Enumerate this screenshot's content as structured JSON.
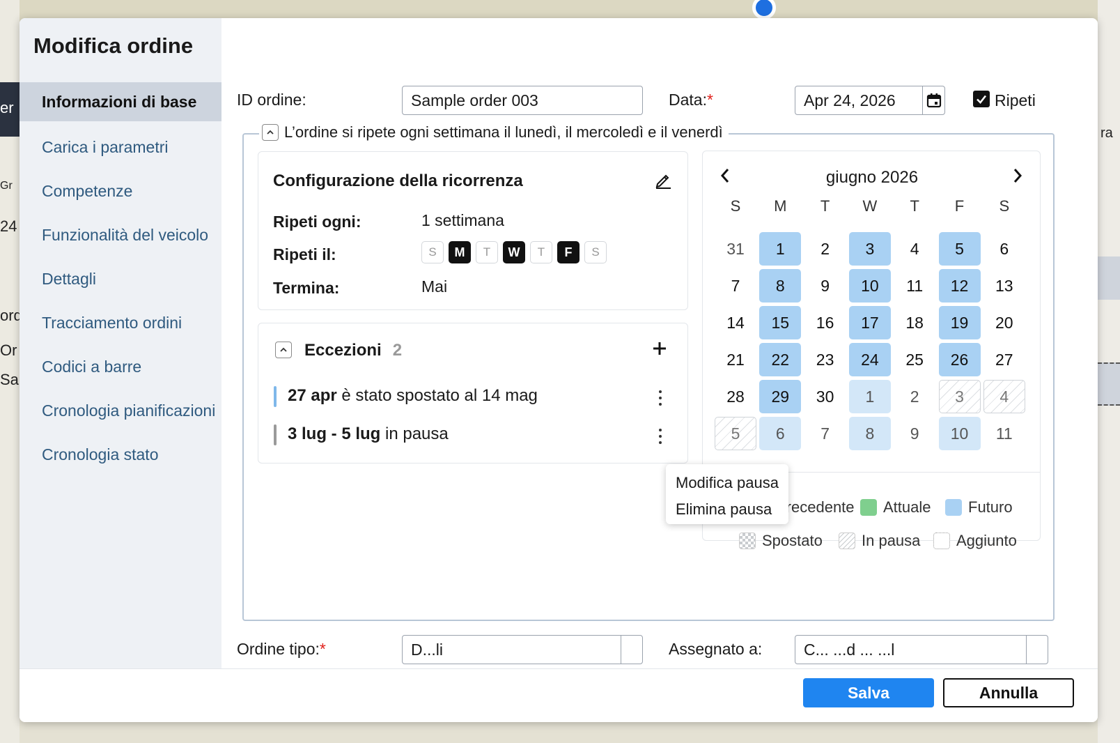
{
  "background": {
    "left_texts": [
      "er",
      "Gr",
      "24",
      "ord",
      "Or",
      "Sa"
    ],
    "right_text": "ra"
  },
  "modal": {
    "title": "Modifica ordine"
  },
  "sidebar": {
    "items": [
      {
        "label": "Informazioni di base",
        "active": true
      },
      {
        "label": "Carica i parametri"
      },
      {
        "label": "Competenze"
      },
      {
        "label": "Funzionalità del veicolo"
      },
      {
        "label": "Dettagli"
      },
      {
        "label": "Tracciamento ordini"
      },
      {
        "label": "Codici a barre"
      },
      {
        "label": "Cronologia pianificazioni"
      },
      {
        "label": "Cronologia stato"
      }
    ]
  },
  "form": {
    "order_id_label": "ID ordine:",
    "order_id_value": "Sample order 003",
    "date_label": "Data:",
    "required_mark": "*",
    "date_value": "Apr 24, 2026",
    "repeat_label": "Ripeti",
    "repeat_checked": true,
    "order_type_label": "Ordine tipo:",
    "order_type_value": "D...li",
    "assigned_label": "Assegnato a:",
    "assigned_value": "C... ...d ... ...l"
  },
  "recurrence": {
    "summary": "L’ordine si ripete ogni settimana il lunedì, il mercoledì e il venerdì",
    "config_title": "Configurazione della ricorrenza",
    "repeat_every_label": "Ripeti ogni:",
    "repeat_every_value": "1 settimana",
    "repeat_on_label": "Ripeti il:",
    "days": [
      {
        "letter": "S",
        "on": false
      },
      {
        "letter": "M",
        "on": true
      },
      {
        "letter": "T",
        "on": false
      },
      {
        "letter": "W",
        "on": true
      },
      {
        "letter": "T",
        "on": false
      },
      {
        "letter": "F",
        "on": true
      },
      {
        "letter": "S",
        "on": false
      }
    ],
    "ends_label": "Termina:",
    "ends_value": "Mai"
  },
  "exceptions": {
    "title": "Eccezioni",
    "count": "2",
    "items": [
      {
        "bold": "27 apr",
        "text": " è stato spostato al 14 mag",
        "color": "#7fb8ea"
      },
      {
        "bold": "3 lug - 5 lug",
        "text": " in pausa",
        "color": "#9a9a9a"
      }
    ]
  },
  "popup_menu": {
    "items": [
      "Modifica pausa",
      "Elimina pausa"
    ]
  },
  "calendar": {
    "month": "giugno 2026",
    "weekdays": [
      "S",
      "M",
      "T",
      "W",
      "T",
      "F",
      "S"
    ],
    "weeks": [
      [
        {
          "d": "31",
          "s": "muted"
        },
        {
          "d": "1",
          "s": "fut"
        },
        {
          "d": "2",
          "s": ""
        },
        {
          "d": "3",
          "s": "fut"
        },
        {
          "d": "4",
          "s": ""
        },
        {
          "d": "5",
          "s": "fut"
        },
        {
          "d": "6",
          "s": ""
        }
      ],
      [
        {
          "d": "7",
          "s": ""
        },
        {
          "d": "8",
          "s": "fut"
        },
        {
          "d": "9",
          "s": ""
        },
        {
          "d": "10",
          "s": "fut"
        },
        {
          "d": "11",
          "s": ""
        },
        {
          "d": "12",
          "s": "fut"
        },
        {
          "d": "13",
          "s": ""
        }
      ],
      [
        {
          "d": "14",
          "s": ""
        },
        {
          "d": "15",
          "s": "fut"
        },
        {
          "d": "16",
          "s": ""
        },
        {
          "d": "17",
          "s": "fut"
        },
        {
          "d": "18",
          "s": ""
        },
        {
          "d": "19",
          "s": "fut"
        },
        {
          "d": "20",
          "s": ""
        }
      ],
      [
        {
          "d": "21",
          "s": ""
        },
        {
          "d": "22",
          "s": "fut"
        },
        {
          "d": "23",
          "s": ""
        },
        {
          "d": "24",
          "s": "fut"
        },
        {
          "d": "25",
          "s": ""
        },
        {
          "d": "26",
          "s": "fut"
        },
        {
          "d": "27",
          "s": ""
        }
      ],
      [
        {
          "d": "28",
          "s": ""
        },
        {
          "d": "29",
          "s": "fut"
        },
        {
          "d": "30",
          "s": ""
        },
        {
          "d": "1",
          "s": "futl"
        },
        {
          "d": "2",
          "s": "muted"
        },
        {
          "d": "3",
          "s": "paused"
        },
        {
          "d": "4",
          "s": "paused"
        }
      ],
      [
        {
          "d": "5",
          "s": "paused"
        },
        {
          "d": "6",
          "s": "futl"
        },
        {
          "d": "7",
          "s": "muted"
        },
        {
          "d": "8",
          "s": "futl"
        },
        {
          "d": "9",
          "s": "muted"
        },
        {
          "d": "10",
          "s": "futl"
        },
        {
          "d": "11",
          "s": "muted"
        }
      ]
    ],
    "legend": [
      {
        "label": "Precedente",
        "kind": "past"
      },
      {
        "label": "Attuale",
        "kind": "current"
      },
      {
        "label": "Futuro",
        "kind": "future"
      },
      {
        "label": "Spostato",
        "kind": "moved"
      },
      {
        "label": "In pausa",
        "kind": "paused"
      },
      {
        "label": "Aggiunto",
        "kind": "added"
      }
    ]
  },
  "colors": {
    "future": "#a9d1f3",
    "current": "#7fcf8e",
    "primary": "#1f85f0",
    "required": "#e0201b"
  },
  "footer": {
    "save_label": "Salva",
    "cancel_label": "Annulla"
  }
}
